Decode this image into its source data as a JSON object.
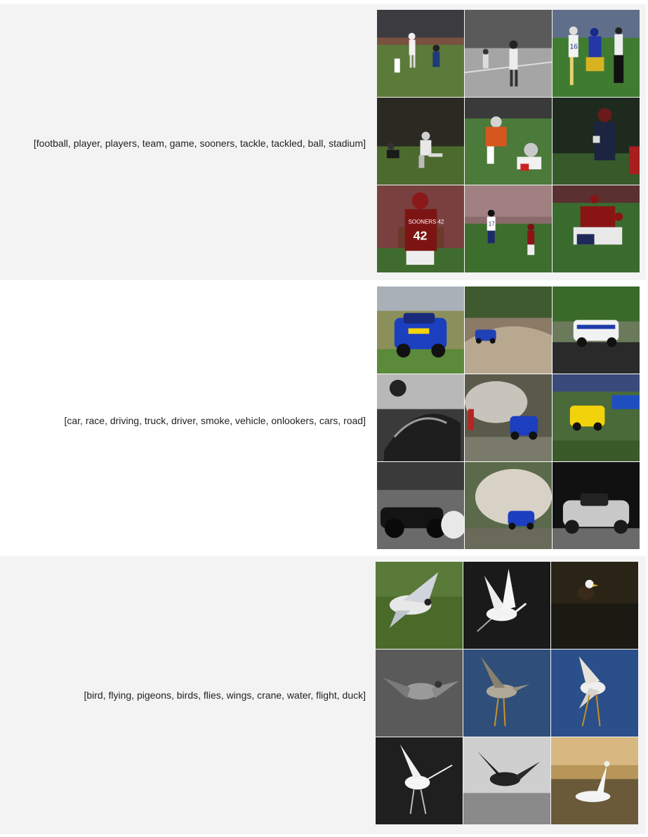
{
  "rows": [
    {
      "keywords": "[football, player, players, team, game, sooners, tackle, tackled, ball, stadium]",
      "images": [
        {
          "label": "football-photo-1"
        },
        {
          "label": "football-photo-2"
        },
        {
          "label": "football-photo-3"
        },
        {
          "label": "football-photo-4"
        },
        {
          "label": "football-photo-5"
        },
        {
          "label": "football-photo-6"
        },
        {
          "label": "football-photo-7",
          "jersey": "SOONERS 42"
        },
        {
          "label": "football-photo-8"
        },
        {
          "label": "football-photo-9"
        }
      ]
    },
    {
      "keywords": "[car, race, driving, truck, driver, smoke, vehicle, onlookers, cars, road]",
      "images": [
        {
          "label": "car-photo-1"
        },
        {
          "label": "car-photo-2"
        },
        {
          "label": "car-photo-3"
        },
        {
          "label": "car-photo-4"
        },
        {
          "label": "car-photo-5"
        },
        {
          "label": "car-photo-6"
        },
        {
          "label": "car-photo-7"
        },
        {
          "label": "car-photo-8"
        },
        {
          "label": "car-photo-9"
        }
      ]
    },
    {
      "keywords": "[bird, flying, pigeons, birds, flies, wings, crane, water, flight, duck]",
      "images": [
        {
          "label": "bird-photo-1"
        },
        {
          "label": "bird-photo-2"
        },
        {
          "label": "bird-photo-3"
        },
        {
          "label": "bird-photo-4"
        },
        {
          "label": "bird-photo-5"
        },
        {
          "label": "bird-photo-6"
        },
        {
          "label": "bird-photo-7"
        },
        {
          "label": "bird-photo-8"
        },
        {
          "label": "bird-photo-9"
        }
      ]
    }
  ],
  "colors": {
    "row_alt_bg": "#f3f3f3",
    "row_plain_bg": "#ffffff",
    "text": "#222222"
  }
}
